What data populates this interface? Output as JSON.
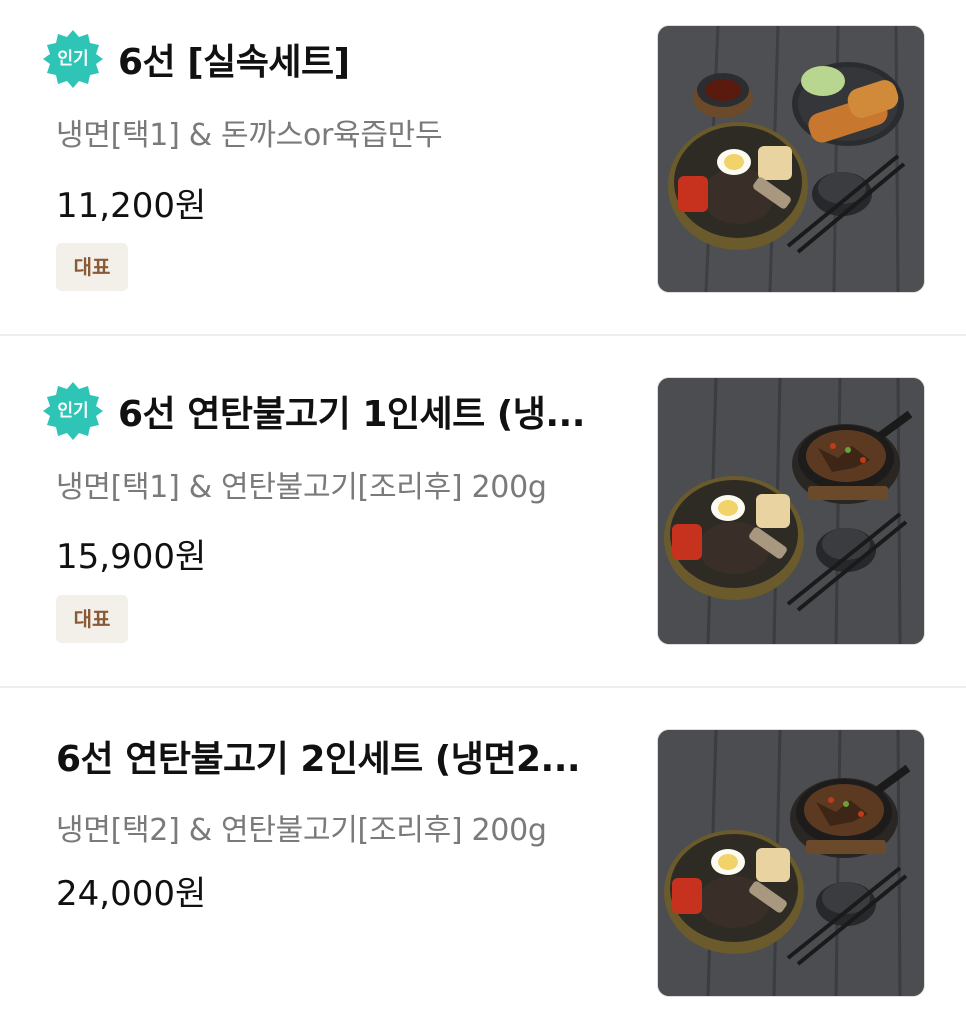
{
  "menu": {
    "items": [
      {
        "badge": "인기",
        "name": "6선 [실속세트]",
        "description": "냉면[택1] & 돈까스or육즙만두",
        "price": "11,200원",
        "tag": "대표",
        "image_icon": "naengmyeon-tonkatsu-photo"
      },
      {
        "badge": "인기",
        "name": "6선 연탄불고기 1인세트 (냉...",
        "description": "냉면[택1] & 연탄불고기[조리후] 200g",
        "price": "15,900원",
        "tag": "대표",
        "image_icon": "naengmyeon-bulgogi-photo"
      },
      {
        "name": "6선 연탄불고기 2인세트 (냉면2...",
        "description": "냉면[택2] & 연탄불고기[조리후] 200g",
        "price": "24,000원",
        "image_icon": "naengmyeon-bulgogi-photo"
      }
    ]
  },
  "colors": {
    "badge": "#2ec4b6",
    "tag_bg": "#f3efe9",
    "tag_text": "#8a5a36",
    "description": "#7a7a7a"
  }
}
